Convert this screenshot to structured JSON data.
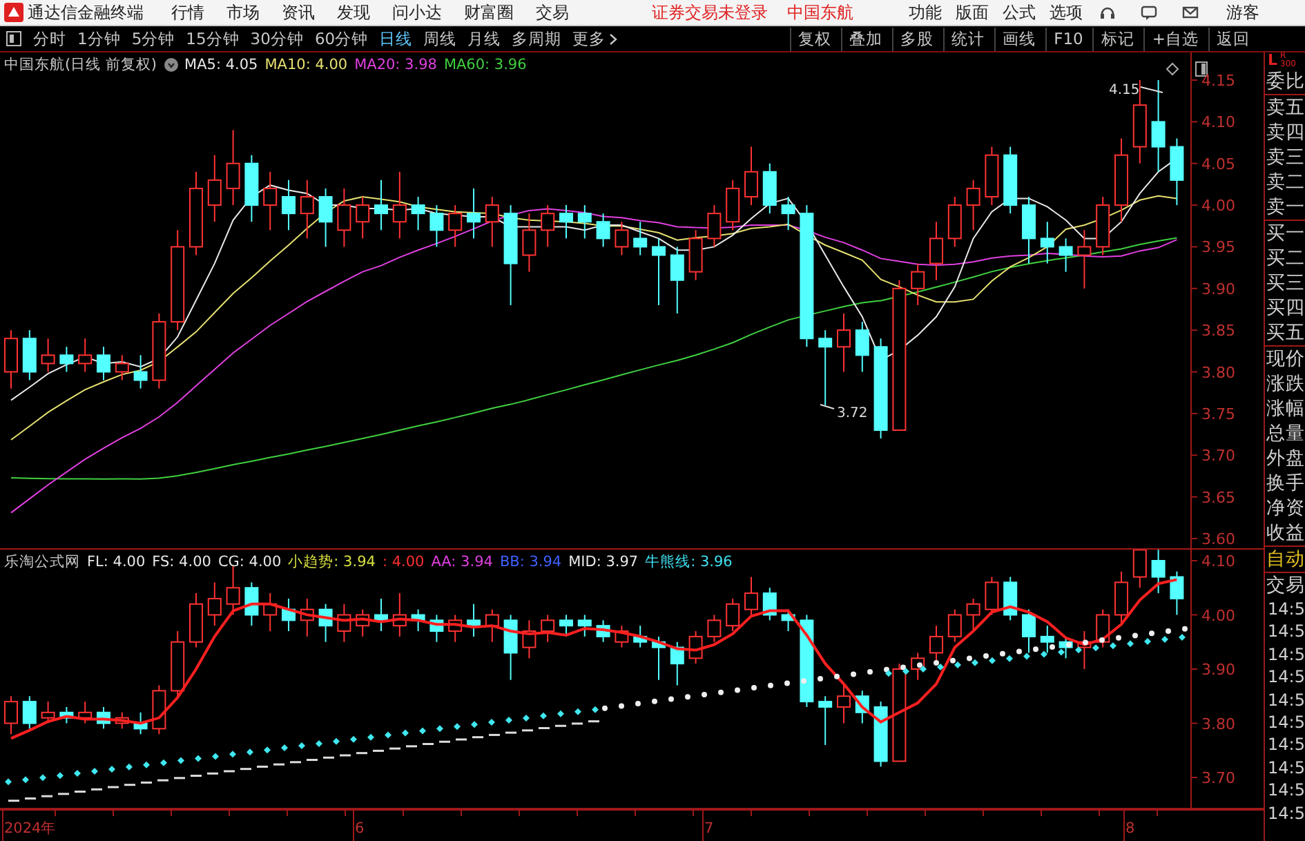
{
  "menubar": {
    "app_title": "通达信金融终端",
    "menus": [
      "行情",
      "市场",
      "资讯",
      "发现",
      "问小达",
      "财富圈",
      "交易"
    ],
    "status_texts": [
      "证券交易未登录",
      "中国东航"
    ],
    "right_menus": [
      "功能",
      "版面",
      "公式",
      "选项"
    ],
    "user": "游客"
  },
  "toolbar": {
    "periods": [
      {
        "label": "分时",
        "selected": false
      },
      {
        "label": "1分钟",
        "selected": false
      },
      {
        "label": "5分钟",
        "selected": false
      },
      {
        "label": "15分钟",
        "selected": false
      },
      {
        "label": "30分钟",
        "selected": false
      },
      {
        "label": "60分钟",
        "selected": false
      },
      {
        "label": "日线",
        "selected": true
      },
      {
        "label": "周线",
        "selected": false
      },
      {
        "label": "月线",
        "selected": false
      },
      {
        "label": "多周期",
        "selected": false
      },
      {
        "label": "更多",
        "selected": false
      }
    ],
    "tools": [
      "复权",
      "叠加",
      "多股",
      "统计",
      "画线",
      "F10",
      "标记",
      "+自选",
      "返回"
    ]
  },
  "main_chart": {
    "title": "中国东航(日线 前复权)",
    "indicators": [
      {
        "label": "MA5: 4.05",
        "color": "#e8e8e8"
      },
      {
        "label": "MA10: 4.00",
        "color": "#e6e070"
      },
      {
        "label": "MA20: 3.98",
        "color": "#e040e0"
      },
      {
        "label": "MA60: 3.96",
        "color": "#40d040"
      }
    ],
    "high_label": "4.15",
    "low_label": "3.72",
    "price_axis": [
      "4.15",
      "4.10",
      "4.05",
      "4.00",
      "3.95",
      "3.90",
      "3.85",
      "3.80",
      "3.75",
      "3.70",
      "3.65",
      "3.60"
    ]
  },
  "sub_chart": {
    "title": "乐淘公式网",
    "indicators": [
      {
        "label": "FL: 4.00",
        "color": "#e8e8e8"
      },
      {
        "label": "FS: 4.00",
        "color": "#e8e8e8"
      },
      {
        "label": "CG: 4.00",
        "color": "#e8e8e8"
      },
      {
        "label": "小趋势: 3.94",
        "color": "#d8e040"
      },
      {
        "label": ": 4.00",
        "color": "#ff3030"
      },
      {
        "label": "AA: 3.94",
        "color": "#e040e0"
      },
      {
        "label": "BB: 3.94",
        "color": "#4060ff"
      },
      {
        "label": "MID: 3.97",
        "color": "#e8e8e8"
      },
      {
        "label": "牛熊线: 3.96",
        "color": "#40e0f0"
      }
    ],
    "price_axis": [
      "4.10",
      "4.00",
      "3.90",
      "3.80",
      "3.70"
    ]
  },
  "date_axis": [
    "2024年",
    "6",
    "7",
    "8"
  ],
  "side_panel": {
    "corner_left": "L",
    "corner_right": "R",
    "corner_count": "300",
    "groups": [
      {
        "labels": [
          "委比"
        ]
      },
      {
        "labels": [
          "卖五",
          "卖四",
          "卖三",
          "卖二",
          "卖一"
        ]
      },
      {
        "labels": [
          "买一",
          "买二",
          "买三",
          "买四",
          "买五"
        ]
      },
      {
        "labels": [
          "现价",
          "涨跌",
          "涨幅",
          "总量",
          "外盘",
          "换手",
          "净资",
          "收益"
        ]
      }
    ],
    "mode": "自动",
    "tab": "交易",
    "times": [
      "14:5",
      "14:5",
      "14:5",
      "14:5",
      "14:5",
      "14:5",
      "14:5",
      "14:5",
      "14:5",
      "14:5"
    ]
  }
}
